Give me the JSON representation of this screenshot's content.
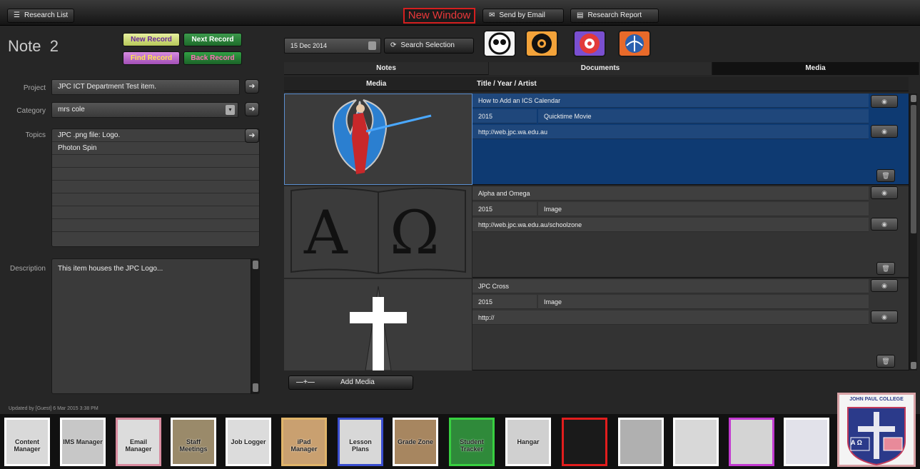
{
  "topbar": {
    "research_list": "Research List",
    "new_window": "New Window",
    "send_by_email": "Send by Email",
    "research_report": "Research Report"
  },
  "record": {
    "title": "Note",
    "number": "2",
    "buttons": {
      "new": "New Record",
      "next": "Next Record",
      "find": "Find Record",
      "back": "Back Record"
    }
  },
  "form": {
    "project_label": "Project",
    "project_value": "JPC ICT Department Test item.",
    "category_label": "Category",
    "category_value": "mrs cole",
    "topics_label": "Topics",
    "topics": [
      "JPC .png file: Logo.",
      "Photon Spin",
      "",
      "",
      "",
      "",
      "",
      ""
    ],
    "description_label": "Description",
    "description_value": "This item houses the JPC Logo..."
  },
  "updated": "Updated by [Guest] 6 Mar 2015 3:38 PM",
  "media_panel": {
    "date": "15 Dec 2014",
    "search_selection": "Search Selection",
    "tabs": [
      "Notes",
      "Documents",
      "Media"
    ],
    "active_tab": "Media",
    "col_media": "Media",
    "col_title": "Title / Year / Artist",
    "rows": [
      {
        "title": "How to Add an ICS Calendar",
        "year": "2015",
        "type": "Quicktime Movie",
        "url": "http://web.jpc.wa.edu.au",
        "selected": true
      },
      {
        "title": "Alpha and Omega",
        "year": "2015",
        "type": "Image",
        "url": "http://web.jpc.wa.edu.au/schoolzone",
        "selected": false
      },
      {
        "title": "JPC Cross",
        "year": "2015",
        "type": "Image",
        "url": "http://",
        "selected": false
      }
    ],
    "add_media": "Add Media",
    "alpha": "A",
    "omega": "Ω"
  },
  "dock": [
    {
      "label": "Content Manager",
      "border": "#ffffff",
      "bg": "#d9d9d9"
    },
    {
      "label": "IMS Manager",
      "border": "#ffffff",
      "bg": "#c7c7c7"
    },
    {
      "label": "Email Manager",
      "border": "#d98ca0",
      "bg": "#dcdcdc"
    },
    {
      "label": "Staff Meetings",
      "border": "#ffffff",
      "bg": "#9a8a6a"
    },
    {
      "label": "Job Logger",
      "border": "#ffffff",
      "bg": "#dcdcdc"
    },
    {
      "label": "iPad Manager",
      "border": "#e0b46a",
      "bg": "#c9a070"
    },
    {
      "label": "Lesson Plans",
      "border": "#3a4fd0",
      "bg": "#d8d8d8"
    },
    {
      "label": "Grade Zone",
      "border": "#ffffff",
      "bg": "#a78660"
    },
    {
      "label": "Student Tracker",
      "border": "#38d040",
      "bg": "#2f8a3a"
    },
    {
      "label": "Hangar",
      "border": "#ffffff",
      "bg": "#d0d0d0"
    },
    {
      "label": "",
      "border": "#e11d1d",
      "bg": "#1a1a1a"
    },
    {
      "label": "",
      "border": "#ffffff",
      "bg": "#b0b0b0"
    },
    {
      "label": "",
      "border": "#ffffff",
      "bg": "#d8d8d8"
    },
    {
      "label": "",
      "border": "#c23ad0",
      "bg": "#d4d4d4"
    },
    {
      "label": "",
      "border": "#ffffff",
      "bg": "#e2e2ea"
    }
  ],
  "college_name": "JOHN PAUL COLLEGE",
  "college_initials": "A Ω"
}
